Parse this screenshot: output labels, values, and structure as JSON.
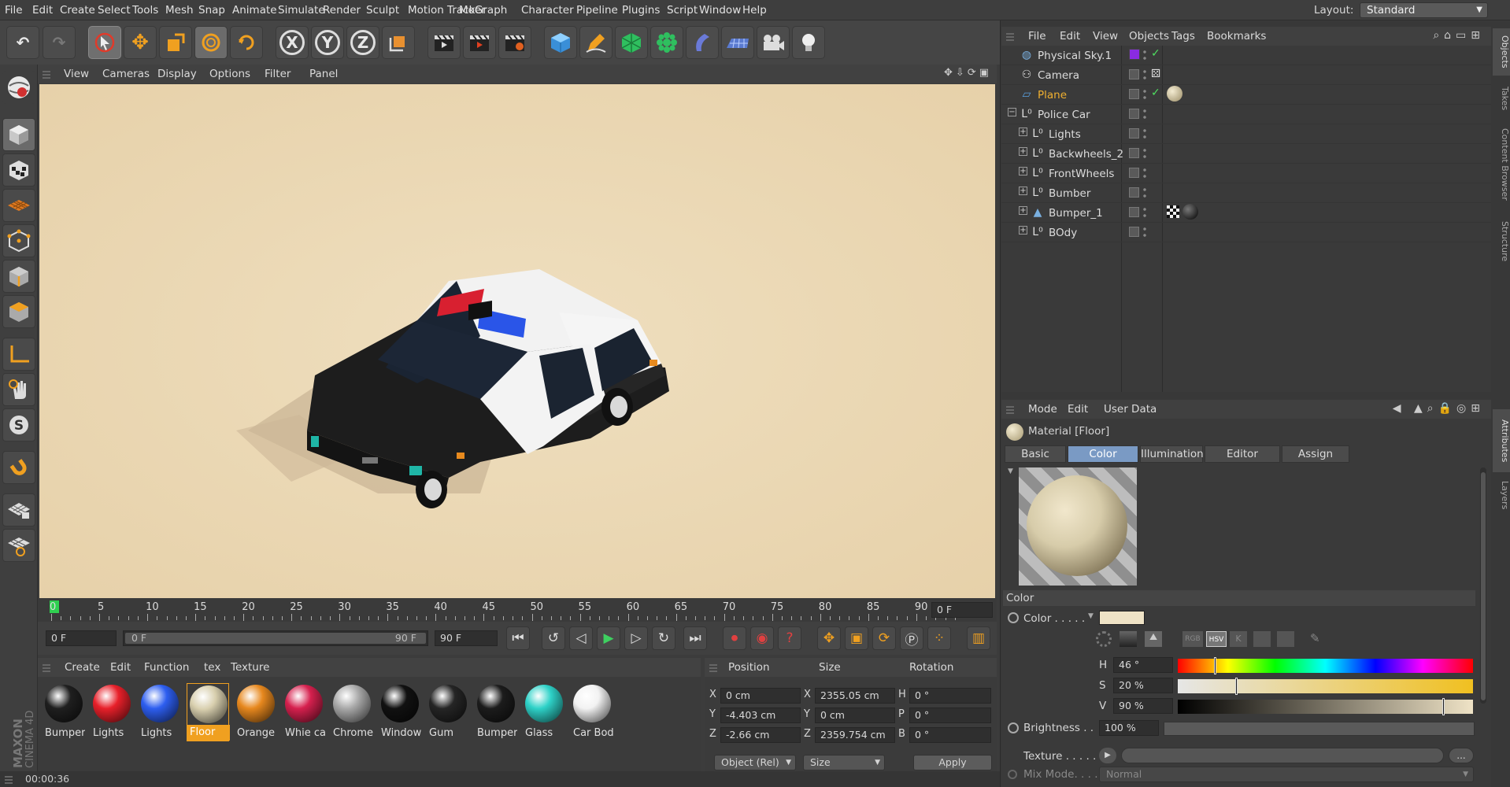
{
  "menubar": {
    "items": [
      "File",
      "Edit",
      "Create",
      "Select",
      "Tools",
      "Mesh",
      "Snap",
      "Animate",
      "Simulate",
      "Render",
      "Sculpt",
      "Motion Tracker",
      "MoGraph",
      "Character",
      "Pipeline",
      "Plugins",
      "Script",
      "Window",
      "Help"
    ],
    "layout_label": "Layout:",
    "layout_value": "Standard"
  },
  "toolbar": {
    "axis_x": "X",
    "axis_y": "Y",
    "axis_z": "Z"
  },
  "viewport": {
    "menu": [
      "View",
      "Cameras",
      "Display",
      "Options",
      "Filter",
      "Panel"
    ],
    "background_color": "#ead8b6"
  },
  "timeline": {
    "ticks": [
      "0",
      "5",
      "10",
      "15",
      "20",
      "25",
      "30",
      "35",
      "40",
      "45",
      "50",
      "55",
      "60",
      "65",
      "70",
      "75",
      "80",
      "85",
      "90"
    ],
    "current_frame": "0 F"
  },
  "transport": {
    "start_frame": "0 F",
    "range_start": "0 F",
    "range_end": "90 F",
    "end_frame": "90 F"
  },
  "materials": {
    "menu": [
      "Create",
      "Edit",
      "Function",
      "tex",
      "Texture"
    ],
    "items": [
      {
        "name": "Bumper",
        "color": "#1f1f1f"
      },
      {
        "name": "Lights",
        "color": "#e8202a"
      },
      {
        "name": "Lights",
        "color": "#2d5ef0"
      },
      {
        "name": "Floor",
        "color": "#d8cfae",
        "selected": true
      },
      {
        "name": "Orange",
        "color": "#e7881e"
      },
      {
        "name": "Whie ca",
        "color": "#d6204e"
      },
      {
        "name": "Chrome",
        "color": "#a9a9a9"
      },
      {
        "name": "Window",
        "color": "#111111"
      },
      {
        "name": "Gum",
        "color": "#252525"
      },
      {
        "name": "Bumper",
        "color": "#1c1c1c"
      },
      {
        "name": "Glass",
        "color": "#2ed2c8"
      },
      {
        "name": "Car Bod",
        "color": "#f2f2f2"
      }
    ]
  },
  "coords": {
    "headers": {
      "position": "Position",
      "size": "Size",
      "rotation": "Rotation"
    },
    "rows": [
      {
        "axis": "X",
        "pos": "0 cm",
        "saxis": "X",
        "size": "2355.05 cm",
        "raxis": "H",
        "rot": "0 °"
      },
      {
        "axis": "Y",
        "pos": "-4.403 cm",
        "saxis": "Y",
        "size": "0 cm",
        "raxis": "P",
        "rot": "0 °"
      },
      {
        "axis": "Z",
        "pos": "-2.66 cm",
        "saxis": "Z",
        "size": "2359.754 cm",
        "raxis": "B",
        "rot": "0 °"
      }
    ],
    "mode": "Object (Rel)",
    "size_mode": "Size",
    "apply": "Apply"
  },
  "status": {
    "time": "00:00:36"
  },
  "objects": {
    "menu": [
      "File",
      "Edit",
      "View",
      "Objects",
      "Tags",
      "Bookmarks"
    ],
    "rows": [
      {
        "name": "Physical Sky.1",
        "indent": 0,
        "color": "#dcdcdc",
        "icon": "sky-icon"
      },
      {
        "name": "Camera",
        "indent": 0,
        "color": "#dcdcdc",
        "icon": "camera-icon"
      },
      {
        "name": "Plane",
        "indent": 0,
        "color": "#f0b030",
        "icon": "plane-icon"
      },
      {
        "name": "Police Car",
        "indent": 0,
        "color": "#dcdcdc",
        "icon": "null-icon",
        "expand": "−"
      },
      {
        "name": "Lights",
        "indent": 1,
        "color": "#dcdcdc",
        "icon": "null-icon",
        "expand": "+"
      },
      {
        "name": "Backwheels_2",
        "indent": 1,
        "color": "#dcdcdc",
        "icon": "null-icon",
        "expand": "+"
      },
      {
        "name": "FrontWheels",
        "indent": 1,
        "color": "#dcdcdc",
        "icon": "null-icon",
        "expand": "+"
      },
      {
        "name": "Bumber",
        "indent": 1,
        "color": "#dcdcdc",
        "icon": "null-icon",
        "expand": "+"
      },
      {
        "name": "Bumper_1",
        "indent": 1,
        "color": "#dcdcdc",
        "icon": "poly-icon",
        "expand": "+"
      },
      {
        "name": "BOdy",
        "indent": 1,
        "color": "#dcdcdc",
        "icon": "null-icon",
        "expand": "+"
      }
    ]
  },
  "side_tabs": [
    "Objects",
    "Takes",
    "Content Browser",
    "Structure",
    "Attributes",
    "Layers"
  ],
  "attributes": {
    "menu": [
      "Mode",
      "Edit",
      "User Data"
    ],
    "title": "Material [Floor]",
    "tabs": [
      "Basic",
      "Color",
      "Illumination",
      "Editor",
      "Assign"
    ],
    "active_tab": "Color",
    "section": "Color",
    "color_label": "Color . . . . .",
    "swatch_color": "#efe3c6",
    "mode_buttons": [
      "RGB",
      "HSV",
      "K"
    ],
    "h_label": "H",
    "h_value": "46 °",
    "h_level": 0.128,
    "s_label": "S",
    "s_value": "20 %",
    "s_level": 0.2,
    "v_label": "V",
    "v_value": "90 %",
    "v_level": 0.9,
    "brightness_label": "Brightness . .",
    "brightness_value": "100 %",
    "texture_label": "Texture . . . . .",
    "texture_more": "...",
    "mixmode_label": "Mix Mode. . . .",
    "mixmode_value": "Normal"
  }
}
